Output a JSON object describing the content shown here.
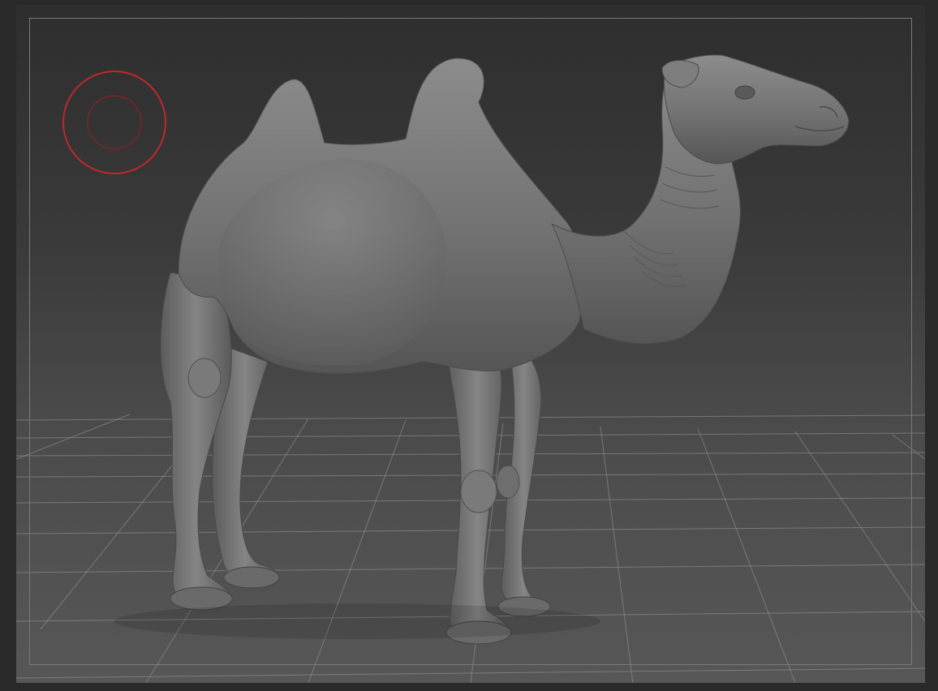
{
  "viewport": {
    "name": "3d-sculpt-viewport",
    "background_top": "#2e2e2e",
    "background_bottom": "#575757",
    "grid_color": "#9a9a9a",
    "frame_color": "#7a7a7a"
  },
  "model": {
    "subject": "camel",
    "material_color": "#7a7a7a"
  },
  "brush_cursor": {
    "outer_color": "#c0282d",
    "inner_color": "#8a2226"
  }
}
